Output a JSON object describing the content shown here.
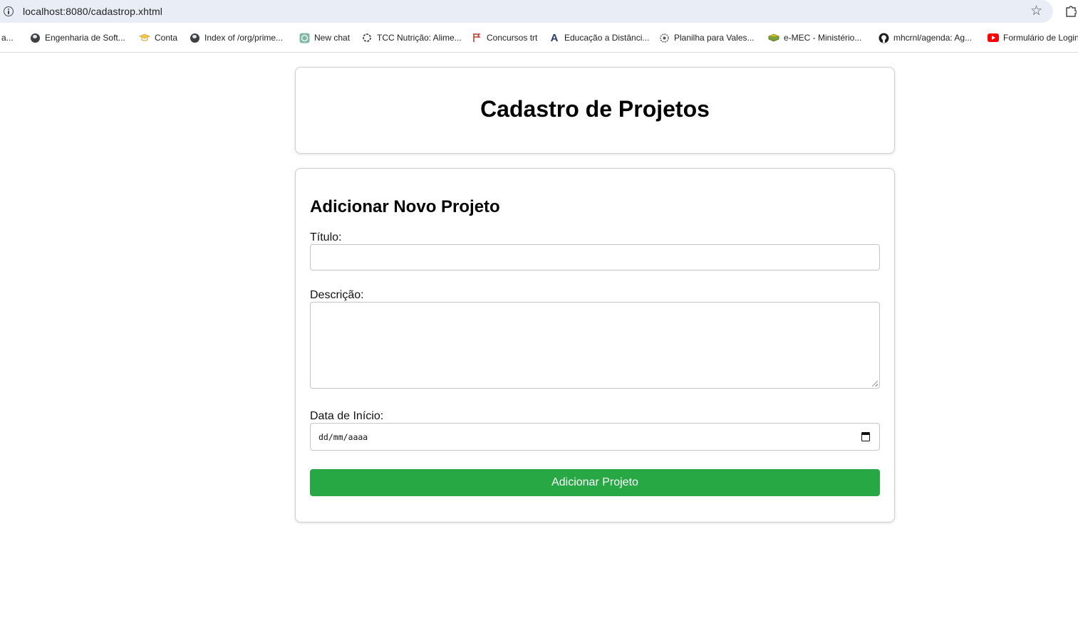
{
  "browser": {
    "url": "localhost:8080/cadastrop.xhtml",
    "bookmarks": [
      {
        "label": "o a...",
        "icon": "partial-icon"
      },
      {
        "label": "Engenharia de Soft...",
        "icon": "globe-icon"
      },
      {
        "label": "Conta",
        "icon": "graduation-cap-icon"
      },
      {
        "label": "Index of /org/prime...",
        "icon": "globe-icon"
      },
      {
        "label": "New chat",
        "icon": "chatgpt-icon"
      },
      {
        "label": "TCC Nutrição: Alime...",
        "icon": "openai-icon"
      },
      {
        "label": "Concursos trt",
        "icon": "flag-icon"
      },
      {
        "label": "Educação a Distânci...",
        "icon": "letter-a-icon"
      },
      {
        "label": "Planilha para Vales...",
        "icon": "gear-face-icon"
      },
      {
        "label": "e-MEC - Ministério...",
        "icon": "book-stack-icon"
      },
      {
        "label": "mhcrnl/agenda: Ag...",
        "icon": "github-icon"
      },
      {
        "label": "Formulário de Login",
        "icon": "youtube-icon"
      }
    ]
  },
  "header": {
    "title": "Cadastro de Projetos"
  },
  "form": {
    "title": "Adicionar Novo Projeto",
    "title_label": "Título:",
    "title_value": "",
    "description_label": "Descrição:",
    "description_value": "",
    "start_date_label": "Data de Início:",
    "start_date_placeholder": "dd/mm/aaaa",
    "submit_label": "Adicionar Projeto"
  },
  "colors": {
    "submit_button": "#28a745",
    "omnibox": "#e9eef6"
  }
}
